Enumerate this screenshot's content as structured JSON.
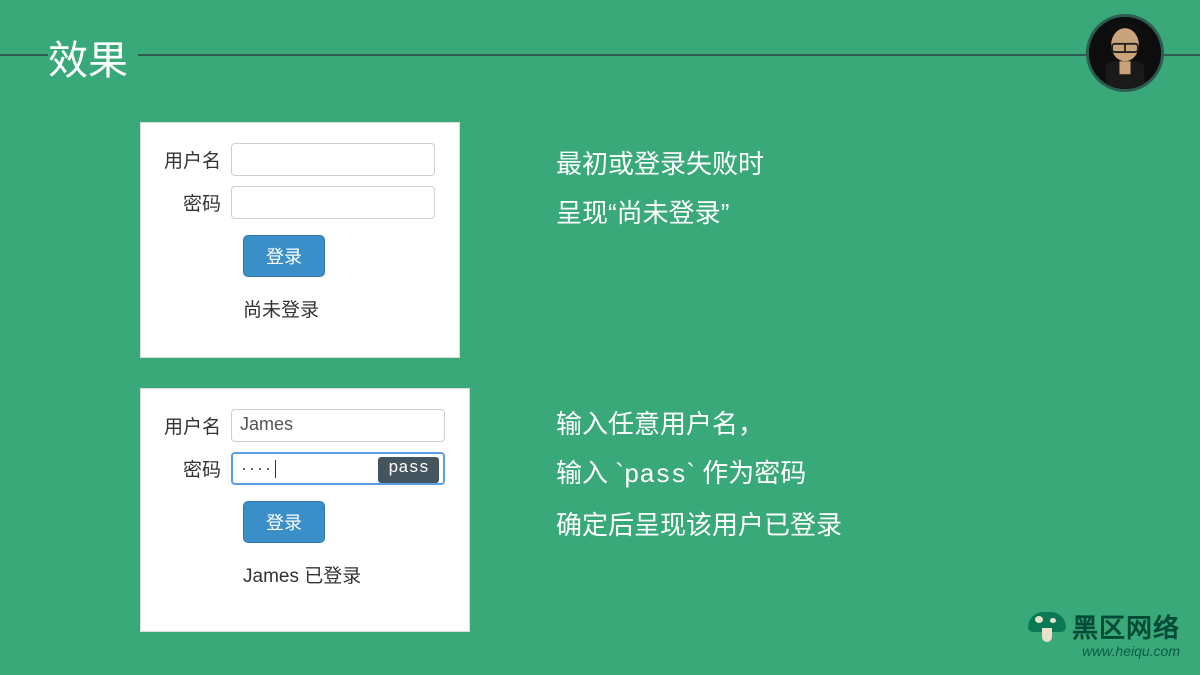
{
  "slide": {
    "title": "效果"
  },
  "avatar": {
    "name": "presenter-photo"
  },
  "form_a": {
    "username_label": "用户名",
    "username_value": "",
    "password_label": "密码",
    "password_value": "",
    "login_button": "登录",
    "status": "尚未登录"
  },
  "form_b": {
    "username_label": "用户名",
    "username_value": "James",
    "password_label": "密码",
    "password_masked": "····",
    "password_hint": "pass",
    "login_button": "登录",
    "status": "James 已登录"
  },
  "caption_a": {
    "line1": "最初或登录失败时",
    "line2_pre": "呈现“",
    "line2_em": "尚未登录",
    "line2_post": "”"
  },
  "caption_b": {
    "line1": "输入任意用户名，",
    "line2_pre": "输入 `",
    "line2_code": "pass",
    "line2_post": "` 作为密码",
    "line3": "确定后呈现该用户已登录"
  },
  "brand": {
    "name": "黑区网络",
    "url": "www.heiqu.com"
  }
}
